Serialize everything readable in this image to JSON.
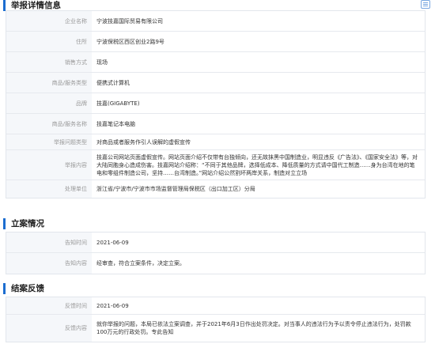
{
  "detail": {
    "title": "举报详情信息",
    "rows": [
      {
        "label": "企业名称",
        "value": "宁波技嘉国际贸易有限公司"
      },
      {
        "label": "住所",
        "value": "宁波保税区西区创业2路9号"
      },
      {
        "label": "销售方式",
        "value": "现场"
      },
      {
        "label": "商品/服务类型",
        "value": "便携式计算机"
      },
      {
        "label": "品牌",
        "value": "技嘉(GIGABYTE)"
      },
      {
        "label": "商品/服务名称",
        "value": "技嘉笔记本电脑"
      },
      {
        "label": "举报问题类型",
        "value": "对商品或者服务作引人误解的虚假宣传"
      },
      {
        "label": "举报内容",
        "value": "技嘉公司网站页面虚假宣传。网站页面介绍不仅带有台独倾向，还无故抹黑中国制造业，明显违反《广告法》、《国家安全法》等，对大陆同胞身心造成伤害。技嘉网站介绍称：“不同于其他品牌，选择低成本、降低质量的方式请中国代工制造……身为台湾在地的笔电和零组件制造公司，坚持……台湾制造。”网站介绍公然割坏两岸关系，制造对立立场"
      },
      {
        "label": "处理单位",
        "value": "浙江省/宁波市/宁波市市场监督管理局保税区（出口加工区）分局"
      }
    ]
  },
  "filing": {
    "title": "立案情况",
    "rows": [
      {
        "label": "告知时间",
        "value": "2021-06-09"
      },
      {
        "label": "告知内容",
        "value": "经审查，符合立案条件，决定立案。"
      }
    ]
  },
  "closing": {
    "title": "结案反馈",
    "rows": [
      {
        "label": "反馈时间",
        "value": "2021-06-09"
      },
      {
        "label": "反馈内容",
        "value": "就你举报的问题，本局已依法立案调查，并于2021年6月3日作出处罚决定。对当事人的违法行为予以责令停止违法行为，处罚款100万元的行政处罚。专此告知"
      }
    ]
  }
}
